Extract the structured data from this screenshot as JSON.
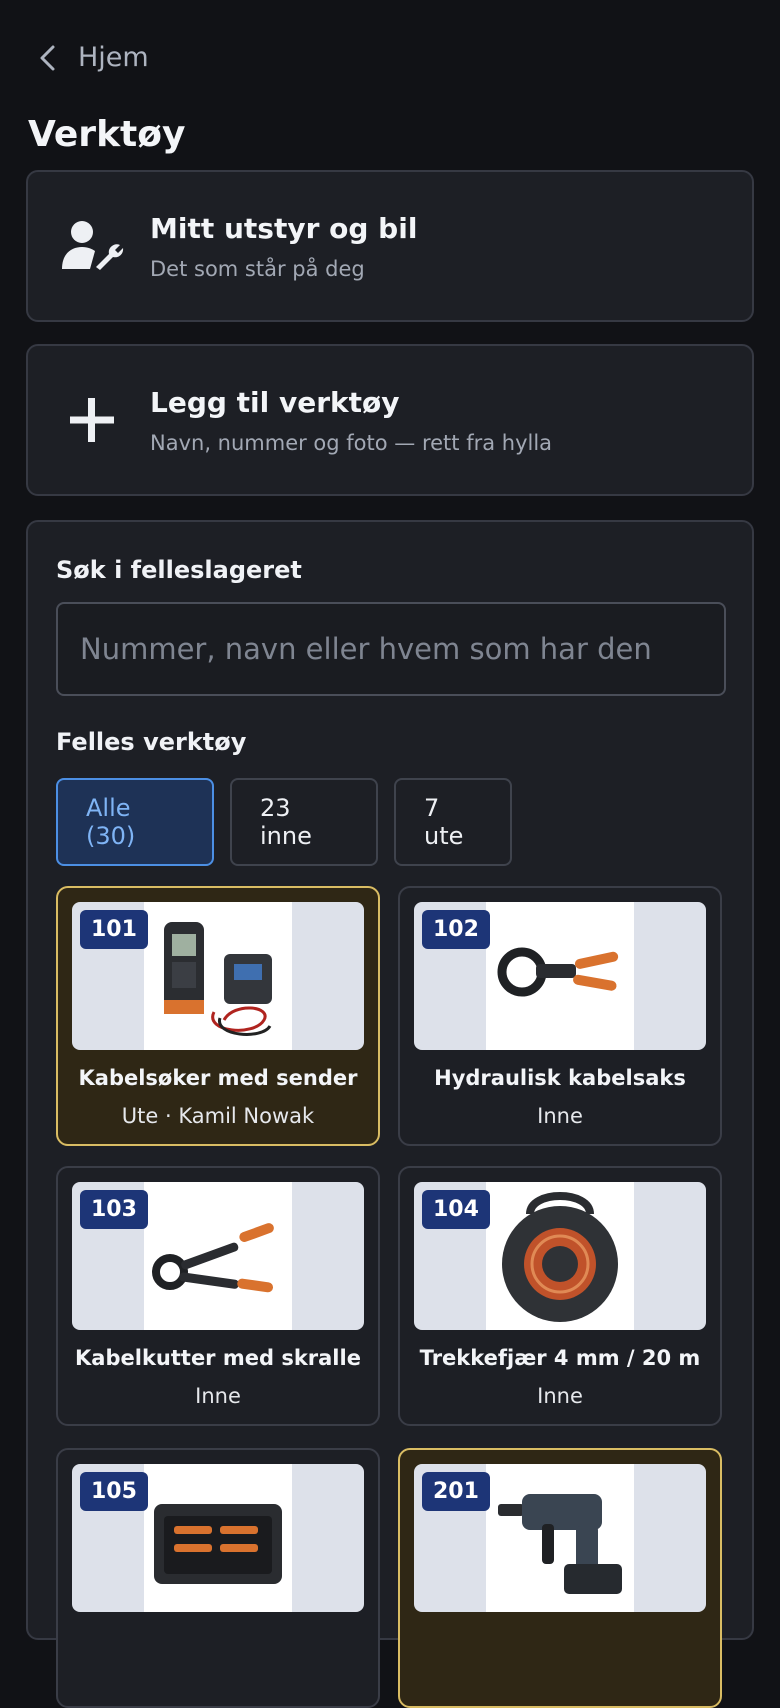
{
  "nav": {
    "back_label": "Hjem",
    "back_icon": "chevron-left-icon"
  },
  "page": {
    "title": "Verktøy"
  },
  "actions": [
    {
      "icon": "user-wrench-icon",
      "title": "Mitt utstyr og bil",
      "subtitle": "Det som står på deg"
    },
    {
      "icon": "plus-icon",
      "title": "Legg til verktøy",
      "subtitle": "Navn, nummer og foto — rett fra hylla"
    }
  ],
  "search": {
    "label": "Søk i felleslageret",
    "placeholder": "Nummer, navn eller hvem som har den",
    "value": ""
  },
  "shared": {
    "label": "Felles verktøy",
    "filters": [
      {
        "label": "Alle (30)",
        "selected": true
      },
      {
        "label": "23 inne",
        "selected": false
      },
      {
        "label": "7 ute",
        "selected": false
      }
    ]
  },
  "tools": [
    {
      "number": "101",
      "name": "Kabelsøker med sender",
      "status": "Ute · Kamil Nowak",
      "out": true,
      "image": "cable-locator-photo"
    },
    {
      "number": "102",
      "name": "Hydraulisk kabelsaks",
      "status": "Inne",
      "out": false,
      "image": "hydraulic-cable-cutter-photo"
    },
    {
      "number": "103",
      "name": "Kabelkutter med skralle",
      "status": "Inne",
      "out": false,
      "image": "ratchet-cable-cutter-photo"
    },
    {
      "number": "104",
      "name": "Trekkefjær 4 mm / 20 m",
      "status": "Inne",
      "out": false,
      "image": "fish-tape-reel-photo"
    },
    {
      "number": "105",
      "name": "",
      "status": "",
      "out": false,
      "image": "tool-case-photo"
    },
    {
      "number": "201",
      "name": "",
      "status": "",
      "out": true,
      "image": "rotary-hammer-photo"
    }
  ],
  "colors": {
    "background": "#111216",
    "card": "#1d1f25",
    "accent": "#4c8fe4",
    "out_border": "#d9bc63",
    "badge": "#1d3577"
  }
}
